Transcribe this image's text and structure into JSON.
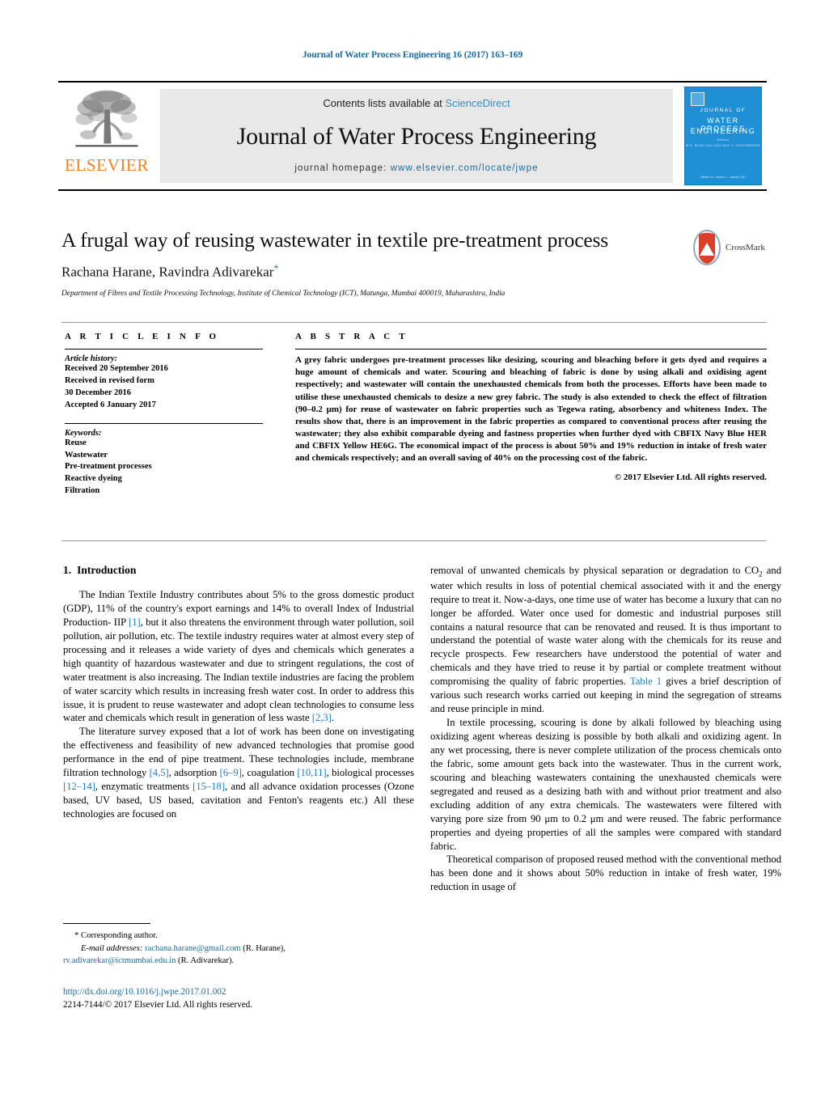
{
  "running_head": "Journal of Water Process Engineering 16 (2017) 163–169",
  "masthead": {
    "contents_prefix": "Contents lists available at ",
    "sciencedirect": "ScienceDirect",
    "journal_name": "Journal of Water Process Engineering",
    "homepage_prefix": "journal homepage: ",
    "homepage_url": "www.elsevier.com/locate/jwpe",
    "publisher_wordmark": "ELSEVIER",
    "cover": {
      "line1": "JOURNAL OF",
      "line2": "WATER PROCESS",
      "line3": "ENGINEERING",
      "sub1": "Editors",
      "sub2": "M.R. BILAD    HUU HAO NGO    V. JEGATHEESAN",
      "footer": "Volume 16 · number 1 · January 2017"
    },
    "colors": {
      "link_blue": "#1a6ba0",
      "sciencedirect_blue": "#3a8fc4",
      "elsevier_orange": "#F08221",
      "cover_blue": "#1f8fd6",
      "masthead_gray": "#e8e8e8"
    }
  },
  "title_block": {
    "title": "A frugal way of reusing wastewater in textile pre-treatment process",
    "authors": "Rachana Harane, Ravindra Adivarekar",
    "corresponding_marker": "*",
    "affiliation": "Department of Fibres and Textile Processing Technology, Institute of Chemical Technology (ICT), Matunga, Mumbai 400019, Maharashtra, India",
    "crossmark_label": "CrossMark"
  },
  "article_info": {
    "heading": "A R T I C L E   I N F O",
    "history_label": "Article history:",
    "history": [
      "Received 20 September 2016",
      "Received in revised form",
      "30 December 2016",
      "Accepted 6 January 2017"
    ],
    "keywords_label": "Keywords:",
    "keywords": [
      "Reuse",
      "Wastewater",
      "Pre-treatment processes",
      "Reactive dyeing",
      "Filtration"
    ]
  },
  "abstract": {
    "heading": "A B S T R A C T",
    "text": "A grey fabric undergoes pre-treatment processes like desizing, scouring and bleaching before it gets dyed and requires a huge amount of chemicals and water. Scouring and bleaching of fabric is done by using alkali and oxidising agent respectively; and wastewater will contain the unexhausted chemicals from both the processes. Efforts have been made to utilise these unexhausted chemicals to desize a new grey fabric. The study is also extended to check the effect of filtration (90–0.2 μm) for reuse of wastewater on fabric properties such as Tegewa rating, absorbency and whiteness Index. The results show that, there is an improvement in the fabric properties as compared to conventional process after reusing the wastewater; they also exhibit comparable dyeing and fastness properties when further dyed with CBFIX Navy Blue HER and CBFIX Yellow HE6G. The economical impact of the process is about 50% and 19% reduction in intake of fresh water and chemicals respectively; and an overall saving of 40% on the processing cost of the fabric.",
    "copyright": "© 2017 Elsevier Ltd. All rights reserved."
  },
  "introduction": {
    "number": "1.",
    "heading": "Introduction",
    "left_paragraphs": [
      "The Indian Textile Industry contributes about 5% to the gross domestic product (GDP), 11% of the country's export earnings and 14% to overall Index of Industrial Production- IIP [1], but it also threatens the environment through water pollution, soil pollution, air pollution, etc. The textile industry requires water at almost every step of processing and it releases a wide variety of dyes and chemicals which generates a high quantity of hazardous wastewater and due to stringent regulations, the cost of water treatment is also increasing. The Indian textile industries are facing the problem of water scarcity which results in increasing fresh water cost. In order to address this issue, it is prudent to reuse wastewater and adopt clean technologies to consume less water and chemicals which result in generation of less waste [2,3].",
      "The literature survey exposed that a lot of work has been done on investigating the effectiveness and feasibility of new advanced technologies that promise good performance in the end of pipe treatment. These technologies include, membrane filtration technology [4,5], adsorption [6–9], coagulation [10,11], biological processes [12–14], enzymatic treatments [15–18], and all advance oxidation processes (Ozone based, UV based, US based, cavitation and Fenton's reagents etc.) All these technologies are focused on"
    ],
    "right_paragraphs": [
      "removal of unwanted chemicals by physical separation or degradation to CO2 and water which results in loss of potential chemical associated with it and the energy require to treat it. Now-a-days, one time use of water has become a luxury that can no longer be afforded. Water once used for domestic and industrial purposes still contains a natural resource that can be renovated and reused. It is thus important to understand the potential of waste water along with the chemicals for its reuse and recycle prospects. Few researchers have understood the potential of water and chemicals and they have tried to reuse it by partial or complete treatment without compromising the quality of fabric properties. Table 1 gives a brief description of various such research works carried out keeping in mind the segregation of streams and reuse principle in mind.",
      "In textile processing, scouring is done by alkali followed by bleaching using oxidizing agent whereas desizing is possible by both alkali and oxidizing agent. In any wet processing, there is never complete utilization of the process chemicals onto the fabric, some amount gets back into the wastewater. Thus in the current work, scouring and bleaching wastewaters containing the unexhausted chemicals were segregated and reused as a desizing bath with and without prior treatment and also excluding addition of any extra chemicals. The wastewaters were filtered with varying pore size from 90 μm to 0.2 μm and were reused. The fabric performance properties and dyeing properties of all the samples were compared with standard fabric.",
      "Theoretical comparison of proposed reused method with the conventional method has been done and it shows about 50% reduction in intake of fresh water, 19% reduction in usage of"
    ],
    "inline_refs": [
      "[1]",
      "[2,3]",
      "[4,5]",
      "[6–9]",
      "[10,11]",
      "[12–14]",
      "[15–18]"
    ],
    "table_link": "Table 1"
  },
  "footnote": {
    "corresponding_star": "*",
    "corresponding_text": "Corresponding author.",
    "email_label": "E-mail addresses:",
    "email1": "rachana.harane@gmail.com",
    "email1_owner": "(R. Harane),",
    "email2": "rv.adivarekar@ictmumbai.edu.in",
    "email2_owner": "(R. Adivarekar)."
  },
  "footer": {
    "doi": "http://dx.doi.org/10.1016/j.jwpe.2017.01.002",
    "issn_line": "2214-7144/© 2017 Elsevier Ltd. All rights reserved."
  }
}
